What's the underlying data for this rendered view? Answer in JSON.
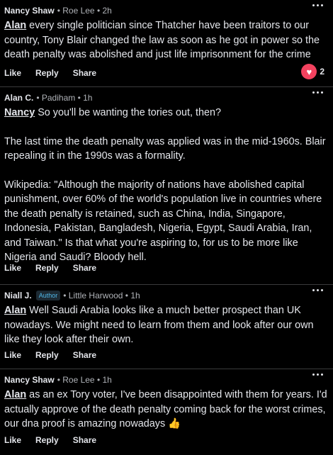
{
  "comments": [
    {
      "author": "Nancy Shaw",
      "meta": "• Roe Lee • 2h",
      "mention": "Alan",
      "paragraphs": [
        " every single politician since Thatcher have been traitors to our country, Tony Blair changed the law as soon as he got in power so the death penalty was abolished and just life imprisonment for the crime"
      ],
      "actions": [
        "Like",
        "Reply",
        "Share"
      ],
      "reactions": {
        "icon": "heart-icon",
        "count": "2"
      }
    },
    {
      "author": "Alan C.",
      "meta": "• Padiham • 1h",
      "mention": "Nancy",
      "paragraphs": [
        " So you'll be wanting the tories out, then?",
        "The last time the death penalty was applied was in the mid-1960s.  Blair repealing it in the 1990s was a formality.",
        "Wikipedia: \"Although the majority of nations have abolished capital punishment, over 60% of the world's population live in countries where the death penalty is retained, such as China, India, Singapore, Indonesia, Pakistan, Bangladesh, Nigeria, Egypt, Saudi Arabia, Iran, and Taiwan.\"  Is that what you're aspiring to, for us to be more like Nigeria and Saudi? Bloody hell."
      ],
      "actions": [
        "Like",
        "Reply",
        "Share"
      ]
    },
    {
      "author": "Niall J.",
      "badge": "Author",
      "meta": "• Little Harwood • 1h",
      "mention": "Alan",
      "paragraphs": [
        " Well Saudi Arabia looks like a much better prospect than UK nowadays. We might need to learn from them and look after our own like they look after their own."
      ],
      "actions": [
        "Like",
        "Reply",
        "Share"
      ]
    },
    {
      "author": "Nancy Shaw",
      "meta": "• Roe Lee • 1h",
      "mention": "Alan",
      "paragraphs": [
        " as an ex Tory voter, I've been disappointed with them for years. I'd actually approve of the death penalty coming back for the worst crimes, our dna proof is amazing nowadays 👍"
      ],
      "actions": [
        "Like",
        "Reply",
        "Share"
      ]
    }
  ],
  "colors": {
    "background": "#000000",
    "text": "#e4e6eb",
    "meta": "#b0b3b8",
    "badge": "#4fb7e8",
    "heart": "#f3425f"
  }
}
